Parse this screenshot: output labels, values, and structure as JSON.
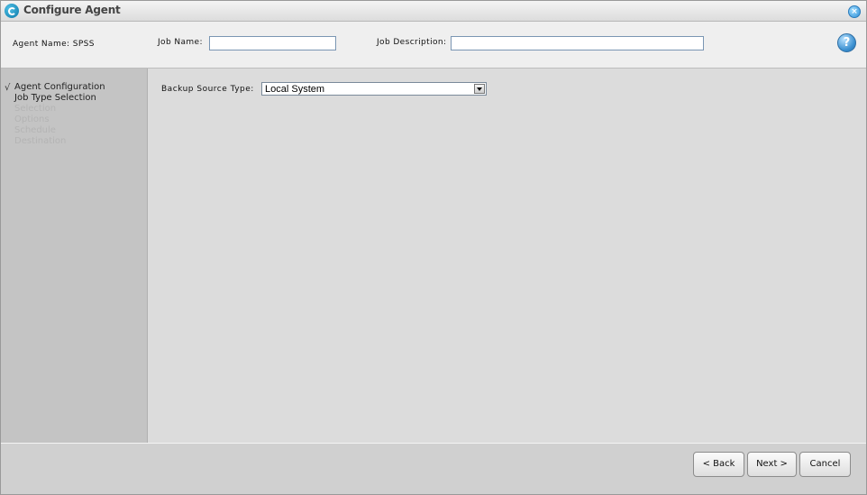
{
  "window": {
    "title": "Configure Agent",
    "logo_icon": "app-logo-icon",
    "close_icon": "close-icon"
  },
  "header": {
    "agent_name": "Agent Name: SPSS",
    "job_name_label": "Job Name:",
    "job_name_value": "",
    "job_description_label": "Job Description:",
    "job_description_value": "",
    "help_icon": "help-icon",
    "help_glyph": "?"
  },
  "wizard": {
    "check_glyph": "√",
    "steps": [
      {
        "label": "Agent Configuration",
        "state": "done"
      },
      {
        "label": "Job Type Selection",
        "state": "current"
      },
      {
        "label": "Selection",
        "state": "future"
      },
      {
        "label": "Options",
        "state": "future"
      },
      {
        "label": "Schedule",
        "state": "future"
      },
      {
        "label": "Destination",
        "state": "future"
      }
    ]
  },
  "content": {
    "backup_source_label": "Backup Source Type:",
    "backup_source_value": "Local System"
  },
  "footer": {
    "back_label": "< Back",
    "next_label": "Next >",
    "cancel_label": "Cancel"
  },
  "colors": {
    "accent": "#2d8fd6",
    "sidebar_bg": "#c4c4c4",
    "content_bg": "#dcdcdc",
    "disabled_text": "#b4b4b4"
  }
}
